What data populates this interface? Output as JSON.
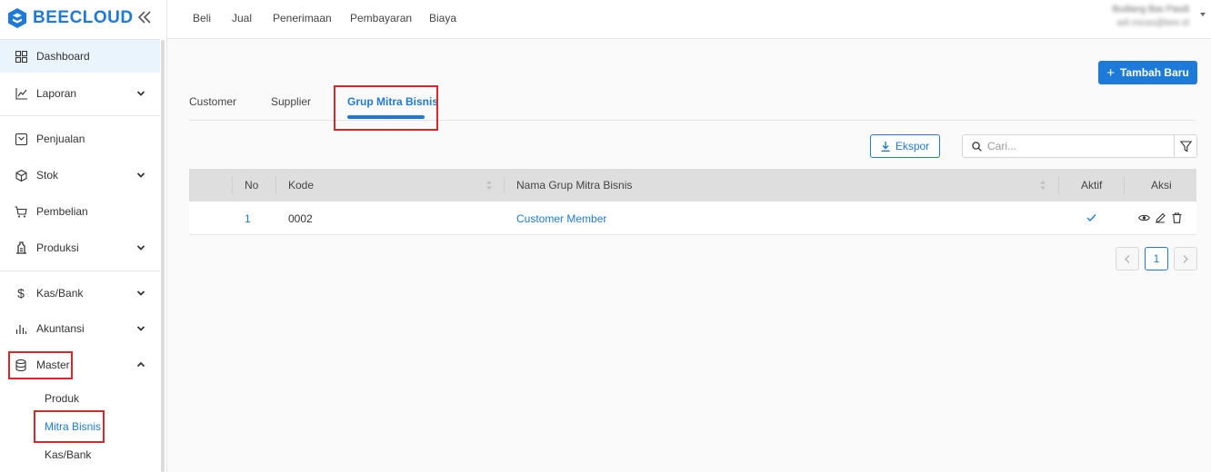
{
  "brand": {
    "name": "BEECLOUD",
    "color": "#1e7ad8"
  },
  "topnav": {
    "links": [
      "Beli",
      "Jual",
      "Penerimaan",
      "Pembayaran",
      "Biaya"
    ],
    "user": {
      "name": "Budiang Bas Pasdi",
      "email": "adi.micas@bee.id"
    }
  },
  "sidebar": {
    "items": [
      {
        "label": "Dashboard",
        "icon": "grid-icon"
      },
      {
        "label": "Laporan",
        "icon": "chart-line-icon"
      },
      {
        "label": "Penjualan",
        "icon": "inbox-icon"
      },
      {
        "label": "Stok",
        "icon": "box-icon"
      },
      {
        "label": "Pembelian",
        "icon": "cart-icon"
      },
      {
        "label": "Produksi",
        "icon": "factory-icon"
      },
      {
        "label": "Kas/Bank",
        "icon": "dollar-icon"
      },
      {
        "label": "Akuntansi",
        "icon": "bar-chart-icon"
      },
      {
        "label": "Master",
        "icon": "database-icon"
      }
    ],
    "master_sub": [
      "Produk",
      "Mitra Bisnis",
      "Kas/Bank"
    ]
  },
  "main": {
    "add_button": "Tambah Baru",
    "tabs": [
      "Customer",
      "Supplier",
      "Grup Mitra Bisnis"
    ],
    "active_tab": "Grup Mitra Bisnis",
    "export_button": "Ekspor",
    "search_placeholder": "Cari...",
    "table": {
      "headers": [
        "No",
        "Kode",
        "Nama Grup Mitra Bisnis",
        "Aktif",
        "Aksi"
      ],
      "rows": [
        {
          "no": "1",
          "kode": "0002",
          "nama": "Customer Member",
          "aktif": true
        }
      ]
    },
    "pagination": {
      "current": "1"
    }
  },
  "colors": {
    "accent": "#1e7ad8",
    "highlight": "#d62828",
    "header_bg": "#dedede"
  }
}
